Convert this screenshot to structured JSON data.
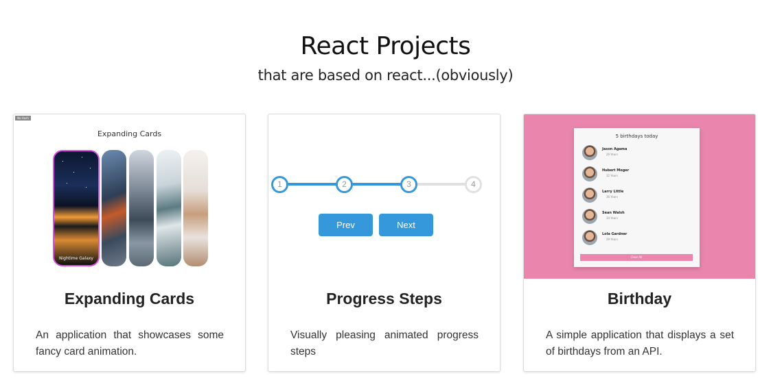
{
  "header": {
    "title": "React Projects",
    "subtitle": "that are based on react...(obviously)"
  },
  "cards": [
    {
      "title": "Expanding Cards",
      "description": "An application that showcases some fancy card animation.",
      "preview": {
        "badge": "No Hash",
        "heading": "Expanding Cards",
        "active_caption": "Nightime Galaxy"
      }
    },
    {
      "title": "Progress Steps",
      "description": "Visually pleasing animated progress steps",
      "preview": {
        "steps": [
          "1",
          "2",
          "3",
          "4"
        ],
        "active_steps": 3,
        "prev_label": "Prev",
        "next_label": "Next"
      }
    },
    {
      "title": "Birthday",
      "description": "A simple application that displays a set of birthdays from an API.",
      "preview": {
        "heading": "5 birthdays today",
        "people": [
          {
            "name": "Jason Agama",
            "age": "29 Years"
          },
          {
            "name": "Hubert Moger",
            "age": "32 Years"
          },
          {
            "name": "Larry Little",
            "age": "36 Years"
          },
          {
            "name": "Sean Walsh",
            "age": "34 Years"
          },
          {
            "name": "Lola Gardner",
            "age": "29 Years"
          }
        ],
        "clear_label": "Clear All"
      }
    }
  ],
  "colors": {
    "accent": "#3498db",
    "birthday_pink": "#ea86ad",
    "active_border": "#d64fe0"
  }
}
